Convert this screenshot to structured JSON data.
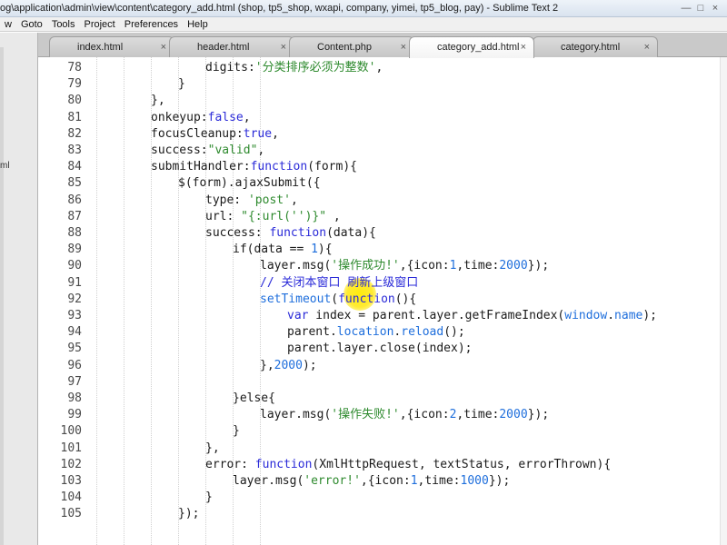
{
  "window": {
    "title": "og\\application\\admin\\view\\content\\category_add.html (shop, tp5_shop, wxapi, company, yimei, tp5_blog, pay) - Sublime Text 2",
    "minimize": "—",
    "maximize": "□",
    "close": "×"
  },
  "menubar": {
    "items": [
      "w",
      "Goto",
      "Tools",
      "Project",
      "Preferences",
      "Help"
    ]
  },
  "sidebar": {
    "text": "ml"
  },
  "tabs": [
    {
      "label": "index.html",
      "close": "×"
    },
    {
      "label": "header.html",
      "close": "×"
    },
    {
      "label": "Content.php",
      "close": "×"
    },
    {
      "label": "category_add.html",
      "close": "×"
    },
    {
      "label": "category.html",
      "close": "×"
    }
  ],
  "editor": {
    "line_numbers": [
      "78",
      "79",
      "80",
      "81",
      "82",
      "83",
      "84",
      "85",
      "86",
      "87",
      "88",
      "89",
      "90",
      "91",
      "92",
      "93",
      "94",
      "95",
      "96",
      "97",
      "98",
      "99",
      "100",
      "101",
      "102",
      "103",
      "104",
      "105"
    ],
    "lines": [
      [
        [
          "fn",
          "digits:"
        ],
        [
          "str",
          "'分类排序必须为整数'"
        ],
        [
          "fn",
          ","
        ]
      ],
      [
        [
          "fn",
          "}"
        ]
      ],
      [
        [
          "fn",
          "},"
        ]
      ],
      [
        [
          "fn",
          "onkeyup:"
        ],
        [
          "kw",
          "false"
        ],
        [
          "fn",
          ","
        ]
      ],
      [
        [
          "fn",
          "focusCleanup:"
        ],
        [
          "kw",
          "true"
        ],
        [
          "fn",
          ","
        ]
      ],
      [
        [
          "fn",
          "success:"
        ],
        [
          "str",
          "\"valid\""
        ],
        [
          "fn",
          ","
        ]
      ],
      [
        [
          "fn",
          "submitHandler:"
        ],
        [
          "kw",
          "function"
        ],
        [
          "fn",
          "(form){"
        ]
      ],
      [
        [
          "fn",
          "$(form).ajaxSubmit({"
        ]
      ],
      [
        [
          "fn",
          "type: "
        ],
        [
          "str",
          "'post'"
        ],
        [
          "fn",
          ","
        ]
      ],
      [
        [
          "fn",
          "url: "
        ],
        [
          "str",
          "\"{:url('')}\""
        ],
        [
          "fn",
          " ,"
        ]
      ],
      [
        [
          "fn",
          "success: "
        ],
        [
          "kw",
          "function"
        ],
        [
          "fn",
          "(data){"
        ]
      ],
      [
        [
          "fn",
          "if(data == "
        ],
        [
          "num",
          "1"
        ],
        [
          "fn",
          "){"
        ]
      ],
      [
        [
          "fn",
          "layer.msg("
        ],
        [
          "str",
          "'操作成功!'"
        ],
        [
          "fn",
          ",{icon:"
        ],
        [
          "num",
          "1"
        ],
        [
          "fn",
          ",time:"
        ],
        [
          "num",
          "2000"
        ],
        [
          "fn",
          "});"
        ]
      ],
      [
        [
          "com",
          "// 关闭本窗口 刷新上级窗口"
        ]
      ],
      [
        [
          "obj",
          "setTimeout"
        ],
        [
          "fn",
          "("
        ],
        [
          "kw",
          "function"
        ],
        [
          "fn",
          "(){"
        ]
      ],
      [
        [
          "kw",
          "var"
        ],
        [
          "fn",
          " index = parent.layer.getFrameIndex("
        ],
        [
          "obj",
          "window"
        ],
        [
          "fn",
          "."
        ],
        [
          "obj",
          "name"
        ],
        [
          "fn",
          ");"
        ]
      ],
      [
        [
          "fn",
          "parent."
        ],
        [
          "obj",
          "location"
        ],
        [
          "fn",
          "."
        ],
        [
          "obj",
          "reload"
        ],
        [
          "fn",
          "();"
        ]
      ],
      [
        [
          "fn",
          "parent.layer.close(index);"
        ]
      ],
      [
        [
          "fn",
          "},"
        ],
        [
          "num",
          "2000"
        ],
        [
          "fn",
          ");"
        ]
      ],
      [
        [
          "fn",
          ""
        ]
      ],
      [
        [
          "fn",
          "}else{"
        ]
      ],
      [
        [
          "fn",
          "layer.msg("
        ],
        [
          "str",
          "'操作失败!'"
        ],
        [
          "fn",
          ",{icon:"
        ],
        [
          "num",
          "2"
        ],
        [
          "fn",
          ",time:"
        ],
        [
          "num",
          "2000"
        ],
        [
          "fn",
          "});"
        ]
      ],
      [
        [
          "fn",
          "}"
        ]
      ],
      [
        [
          "fn",
          "},"
        ]
      ],
      [
        [
          "fn",
          "error: "
        ],
        [
          "kw",
          "function"
        ],
        [
          "fn",
          "(XmlHttpRequest, textStatus, errorThrown){"
        ]
      ],
      [
        [
          "fn",
          "layer.msg("
        ],
        [
          "str",
          "'error!'"
        ],
        [
          "fn",
          ",{icon:"
        ],
        [
          "num",
          "1"
        ],
        [
          "fn",
          ",time:"
        ],
        [
          "num",
          "1000"
        ],
        [
          "fn",
          "});"
        ]
      ],
      [
        [
          "fn",
          "}"
        ]
      ],
      [
        [
          "fn",
          "});"
        ]
      ]
    ]
  }
}
